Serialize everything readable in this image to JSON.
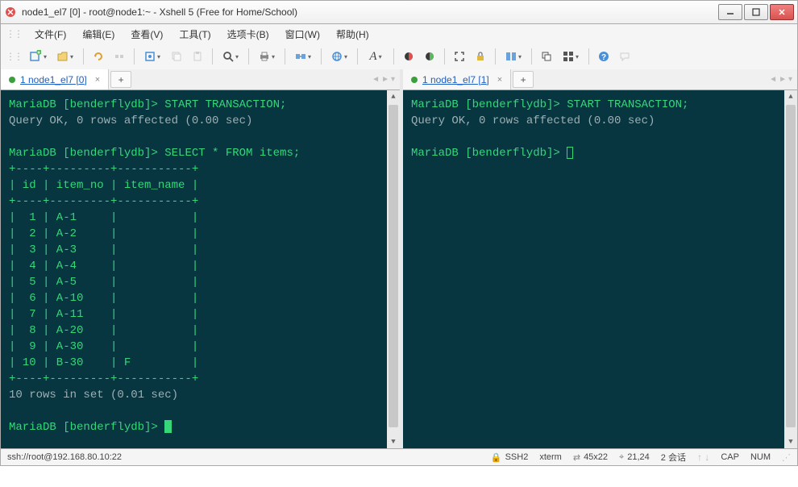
{
  "window": {
    "title": "node1_el7 [0] - root@node1:~ - Xshell 5 (Free for Home/School)"
  },
  "menu": {
    "items": [
      "文件(F)",
      "编辑(E)",
      "查看(V)",
      "工具(T)",
      "选项卡(B)",
      "窗口(W)",
      "帮助(H)"
    ]
  },
  "toolbar_icons": {
    "new": "new-session-icon",
    "open": "open-icon",
    "reconnect": "reconnect-icon",
    "disconnect": "disconnect-icon",
    "properties": "properties-icon",
    "copy": "copy-icon",
    "paste": "paste-icon",
    "find": "find-icon",
    "print": "print-icon",
    "transfer": "transfer-icon",
    "web": "web-icon",
    "font": "font-icon",
    "color1": "color-scheme-icon",
    "color2": "color-scheme2-icon",
    "fullscreen": "fullscreen-icon",
    "lock": "lock-icon",
    "arrange": "arrange-icon",
    "cascade": "cascade-icon",
    "tile": "tile-icon",
    "help": "help-icon",
    "chat": "chat-icon"
  },
  "tabs": {
    "left": {
      "label": "1 node1_el7 [0]"
    },
    "right": {
      "label": "1 node1_el7 [1]"
    },
    "add": "+"
  },
  "terminal_left": {
    "line1_prompt": "MariaDB [benderflydb]> ",
    "line1_cmd": "START TRANSACTION;",
    "line2": "Query OK, 0 rows affected (0.00 sec)",
    "line3_prompt": "MariaDB [benderflydb]> ",
    "line3_cmd": "SELECT * FROM items;",
    "border": "+----+---------+-----------+",
    "header": "| id | item_no | item_name |",
    "rows": [
      "|  1 | A-1     |           |",
      "|  2 | A-2     |           |",
      "|  3 | A-3     |           |",
      "|  4 | A-4     |           |",
      "|  5 | A-5     |           |",
      "|  6 | A-10    |           |",
      "|  7 | A-11    |           |",
      "|  8 | A-20    |           |",
      "|  9 | A-30    |           |",
      "| 10 | B-30    | F         |"
    ],
    "footer": "10 rows in set (0.01 sec)",
    "final_prompt": "MariaDB [benderflydb]> "
  },
  "terminal_right": {
    "line1_prompt": "MariaDB [benderflydb]> ",
    "line1_cmd": "START TRANSACTION;",
    "line2": "Query OK, 0 rows affected (0.00 sec)",
    "final_prompt": "MariaDB [benderflydb]> "
  },
  "statusbar": {
    "conn": "ssh://root@192.168.80.10:22",
    "ssh": "SSH2",
    "term": "xterm",
    "size": "45x22",
    "pos": "21,24",
    "sessions": "2 会话",
    "caps": "CAP",
    "num": "NUM"
  }
}
